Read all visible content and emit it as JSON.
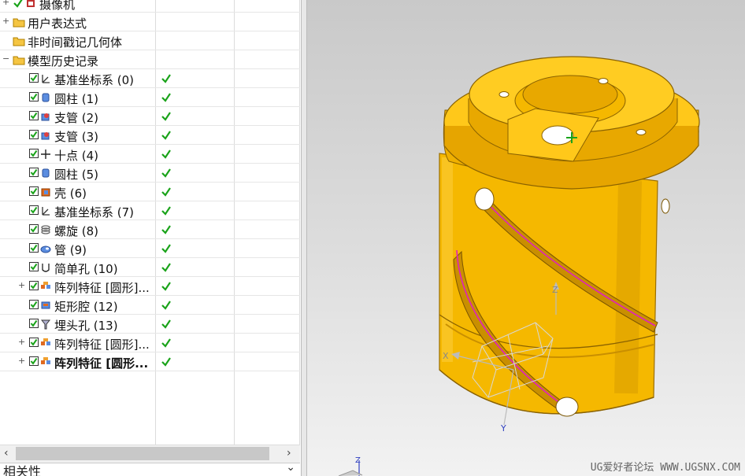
{
  "tree": {
    "rows": [
      {
        "label": "摄像机",
        "expander": "+",
        "check": true,
        "icon": "camera-icon",
        "level": 0
      },
      {
        "label": "用户表达式",
        "expander": "+",
        "folder": true,
        "level": 0
      },
      {
        "label": "非时间戳记几何体",
        "expander": "",
        "folder": true,
        "level": 0
      },
      {
        "label": "模型历史记录",
        "expander": "-",
        "folder": true,
        "level": 0
      },
      {
        "label": "基准坐标系 (0)",
        "icon": "datum-csys-icon",
        "status": true,
        "level": 1
      },
      {
        "label": "圆柱 (1)",
        "icon": "cylinder-icon",
        "status": true,
        "level": 1
      },
      {
        "label": "支管 (2)",
        "icon": "boss-icon",
        "status": true,
        "level": 1
      },
      {
        "label": "支管 (3)",
        "icon": "boss-icon",
        "status": true,
        "level": 1
      },
      {
        "label": "十点 (4)",
        "icon": "point-icon",
        "status": true,
        "level": 1
      },
      {
        "label": "圆柱 (5)",
        "icon": "cylinder-icon",
        "status": true,
        "level": 1
      },
      {
        "label": "壳 (6)",
        "icon": "shell-icon",
        "status": true,
        "level": 1
      },
      {
        "label": "基准坐标系 (7)",
        "icon": "datum-csys-icon",
        "status": true,
        "level": 1
      },
      {
        "label": "螺旋 (8)",
        "icon": "helix-icon",
        "status": true,
        "level": 1
      },
      {
        "label": "管 (9)",
        "icon": "tube-icon",
        "status": true,
        "level": 1
      },
      {
        "label": "简单孔 (10)",
        "icon": "simple-hole-icon",
        "status": true,
        "level": 1
      },
      {
        "label": "阵列特征 [圆形]...",
        "icon": "pattern-icon",
        "status": true,
        "level": 1,
        "expander": "+"
      },
      {
        "label": "矩形腔 (12)",
        "icon": "pocket-icon",
        "status": true,
        "level": 1
      },
      {
        "label": "埋头孔 (13)",
        "icon": "countersink-icon",
        "status": true,
        "level": 1
      },
      {
        "label": "阵列特征 [圆形]...",
        "icon": "pattern-icon",
        "status": true,
        "level": 1,
        "expander": "+"
      },
      {
        "label": "阵列特征 [圆形...",
        "icon": "pattern-icon",
        "status": true,
        "level": 1,
        "expander": "+",
        "bold": true
      }
    ]
  },
  "relations_panel": {
    "title": "相关性"
  },
  "viewport": {
    "axis_x": "X",
    "axis_y": "Y",
    "axis_z": "Z",
    "triad_z": "Z"
  },
  "watermark": "UG爱好者论坛 WWW.UGSNX.COM",
  "colors": {
    "part": "#f5b800",
    "part_dark": "#c98f00",
    "curve": "#e020c0",
    "check": "#1aa31a"
  }
}
